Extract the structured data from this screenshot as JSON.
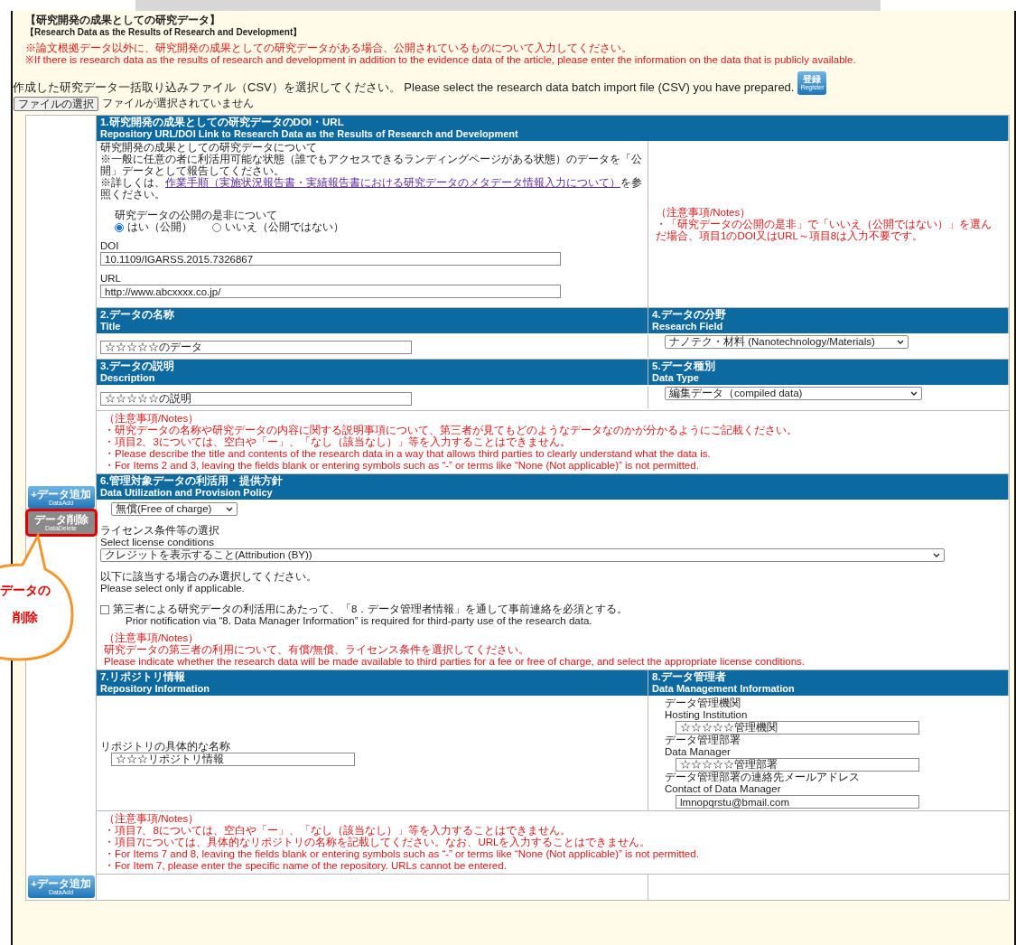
{
  "header": {
    "title_ja": "【研究開発の成果としての研究データ】",
    "title_en": "【Research Data as the Results of Research and Development】",
    "notices": [
      "※論文根拠データ以外に、研究開発の成果としての研究データがある場合、公開されているものについて入力してください。",
      "※If there is research data as the results of research and development in addition to the evidence data of the article, please enter the information on the data that is publicly available."
    ]
  },
  "import": {
    "prompt": "作成した研究データ一括取り込みファイル（CSV）を選択してください。 Please select the research data batch import file (CSV) you have prepared.",
    "register_button": {
      "label": "登録",
      "sublabel": "Register"
    },
    "file_button": "ファイルの選択",
    "file_status": "ファイルが選択されていません"
  },
  "item1": {
    "heading_ja": "1.研究開発の成果としての研究データのDOI・URL",
    "heading_en": "Repository URL/DOI Link to Research Data as the Results of Research and Development",
    "intro": "研究開発の成果としての研究データについて",
    "rule": "※一般に任意の者に利活用可能な状態（誰でもアクセスできるランディングページがある状態）のデータを「公開」データとして報告してください。",
    "details_before": "※詳しくは、",
    "link": "作業手順（実施状況報告書・実績報告書における研究データのメタデータ情報入力について）",
    "details_after": "を参照ください。",
    "publish_label": "研究データの公開の是非について",
    "publish_options": [
      {
        "label": "はい（公開）",
        "selected": true
      },
      {
        "label": "いいえ（公開ではない）",
        "selected": false
      }
    ],
    "doi_label": "DOI",
    "doi": "10.1109/IGARSS.2015.7326867",
    "url_label": "URL",
    "url": "http://www.abcxxxx.co.jp/",
    "notes_title": "（注意事項/Notes）",
    "notes": [
      "・「研究データの公開の是非」で「いいえ（公開ではない）」を選んだ場合、項目1のDOI又はURL～項目8は入力不要です。"
    ]
  },
  "item2": {
    "heading_ja": "2.データの名称",
    "heading_en": "Title",
    "value": "☆☆☆☆☆のデータ"
  },
  "item4": {
    "heading_ja": "4.データの分野",
    "heading_en": "Research Field",
    "value": "ナノテク・材料 (Nanotechnology/Materials)"
  },
  "item3": {
    "heading_ja": "3.データの説明",
    "heading_en": "Description",
    "value": "☆☆☆☆☆の説明"
  },
  "item5": {
    "heading_ja": "5.データ種別",
    "heading_en": "Data Type",
    "value": "編集データ（compiled data)"
  },
  "notes_2_5": {
    "title": "（注意事項/Notes）",
    "lines": [
      "・研究データの名称や研究データの内容に関する説明事項について、第三者が見てもどのようなデータなのかが分かるようにご記載ください。",
      "・項目2、3については、空白や「ー」、「なし（該当なし）」等を入力することはできません。",
      "・Please describe the title and contents of the research data in a way that allows third parties to clearly understand what the data is.",
      "・For Items 2 and 3, leaving the fields blank or entering symbols such as “-” or terms like “None (Not applicable)” is not permitted."
    ]
  },
  "add_buttons": [
    {
      "label": "+データ追加",
      "sublabel": "DataAdd"
    },
    {
      "label": "+データ追加",
      "sublabel": "DataAdd"
    }
  ],
  "delete_button": {
    "label": "データ削除",
    "sublabel": "DataDelete",
    "highlighted": true
  },
  "callout": [
    "データの",
    "削除"
  ],
  "item6": {
    "heading_ja": "6.管理対象データの利活用・提供方針",
    "heading_en": "Data Utilization and Provision Policy",
    "fee": "無償(Free of charge)",
    "license_label_ja": "ライセンス条件等の選択",
    "license_label_en": "Select license conditions",
    "license": "クレジットを表示すること(Attribution (BY))",
    "applicable_ja": "以下に該当する場合のみ選択してください。",
    "applicable_en": "Please select only if applicable.",
    "prior": {
      "label": "第三者による研究データの利活用にあたって、「8．データ管理者情報」を通して事前連絡を必須とする。",
      "label_en": "Prior notification via “8. Data Manager Information” is required for third-party use of the research data.",
      "checked": false
    },
    "notes_title": "（注意事項/Notes）",
    "notes": [
      "研究データの第三者の利用について、有償/無償、ライセンス条件を選択してください。",
      "Please indicate whether the research data will be made available to third parties for a fee or free of charge, and select the appropriate license conditions."
    ]
  },
  "item7": {
    "heading_ja": "7.リポジトリ情報",
    "heading_en": "Repository Information",
    "label": "リポジトリの具体的な名称",
    "value": "☆☆☆リポジトリ情報"
  },
  "item8": {
    "heading_ja": "8.データ管理者",
    "heading_en": "Data Management Information",
    "fields": [
      {
        "label_ja": "データ管理機関",
        "label_en": "Hosting Institution",
        "value": "☆☆☆☆☆管理機関"
      },
      {
        "label_ja": "データ管理部署",
        "label_en": "Data Manager",
        "value": "☆☆☆☆☆管理部署"
      },
      {
        "label_ja": "データ管理部署の連絡先メールアドレス",
        "label_en": "Contact of Data Manager",
        "value": "lmnopqrstu@bmail.com"
      }
    ]
  },
  "notes_7_8": {
    "title": "（注意事項/Notes）",
    "lines": [
      "・項目7、8については、空白や「ー」、「なし（該当なし）」等を入力することはできません。",
      "・項目7については、具体的なリポジトリの名称を記載してください。なお、URLを入力することはできません。",
      "・For Items 7 and 8, leaving the fields blank or entering symbols such as “-” or terms like “None (Not applicable)” is not permitted.",
      "・For Item 7, please enter the specific name of the repository. URLs cannot be entered."
    ]
  }
}
